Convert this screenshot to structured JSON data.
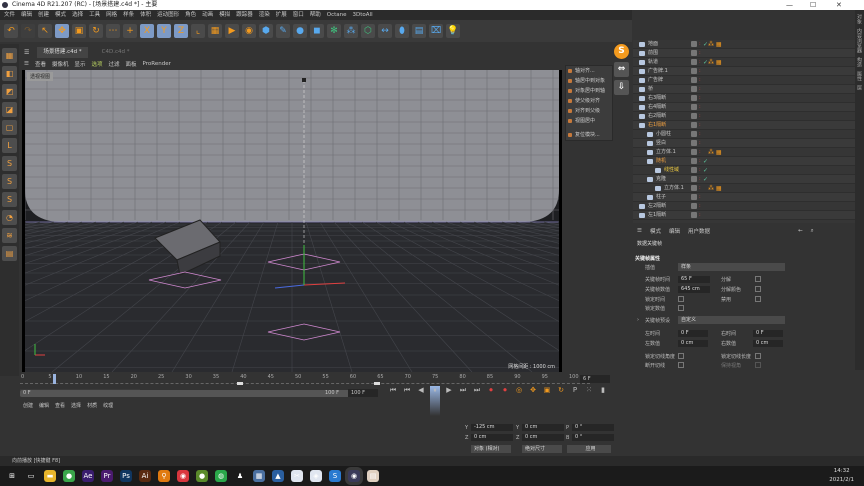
{
  "title": "Cinema 4D R21.207 (RC) - [场景搭建.c4d *] - 主要",
  "window_controls": [
    "—",
    "☐",
    "✕"
  ],
  "menu": [
    "文件",
    "编辑",
    "创建",
    "模式",
    "选择",
    "工具",
    "网格",
    "样条",
    "体积",
    "运动图形",
    "角色",
    "动画",
    "模拟",
    "跟踪器",
    "渲染",
    "扩展",
    "窗口",
    "帮助",
    "Octane",
    "3DtoAll"
  ],
  "toolbar_icons": [
    "undo-icon",
    "redo-icon",
    "select-icon",
    "move-icon",
    "scale-icon",
    "rotate-icon",
    "recent-icon",
    "add-icon",
    "x-axis-icon",
    "y-axis-icon",
    "z-axis-icon",
    "coordinate-icon",
    "render-view-icon",
    "render-picture-icon",
    "render-settings-icon",
    "cube-icon",
    "pen-icon",
    "subdivision-icon",
    "extrude-icon",
    "cloner-icon",
    "mograph-icon",
    "array-icon",
    "deformer-icon",
    "capsule-icon",
    "floor-icon",
    "camera-icon",
    "light-icon"
  ],
  "toolbar_glyphs": [
    "↶",
    "↷",
    "↖",
    "✥",
    "▣",
    "↻",
    "⋯",
    "+",
    "X",
    "Y",
    "Z",
    "⌞",
    "▦",
    "▶",
    "◉",
    "⬢",
    "✎",
    "●",
    "◼",
    "✻",
    "⁂",
    "⬡",
    "↔",
    "⬮",
    "▤",
    "⌧",
    "💡"
  ],
  "left_tools": [
    "▦",
    "◧",
    "◩",
    "◪",
    "▢",
    "L",
    "S",
    "S",
    "S",
    "◔",
    "≋",
    "▤"
  ],
  "tabs": [
    {
      "label": "场景搭建.c4d *",
      "active": true
    },
    {
      "label": "C4D.c4d *",
      "active": false
    }
  ],
  "viewport_menu": [
    "查看",
    "摄像机",
    "显示",
    "选项",
    "过滤",
    "面板",
    "ProRender"
  ],
  "viewport": {
    "label": "透视视图",
    "grid_spacing": "网格间距 : 1000 cm"
  },
  "snap_menu": [
    "轴对齐...",
    "轴居中到对象",
    "对象居中到轴",
    "使父级对齐",
    "对齐到父级",
    "视图居中",
    "复位模块..."
  ],
  "right_buttons": [
    "S",
    "⇔",
    "⇩"
  ],
  "objects": [
    {
      "name": "地面",
      "depth": 0,
      "check": true,
      "tag": true
    },
    {
      "name": "前围",
      "depth": 0
    },
    {
      "name": "轨道",
      "depth": 0,
      "check": true,
      "tag": true
    },
    {
      "name": "广告牌.1",
      "depth": 0
    },
    {
      "name": "广告牌",
      "depth": 0
    },
    {
      "name": "桥",
      "depth": 0
    },
    {
      "name": "右3隔断",
      "depth": 0
    },
    {
      "name": "右4隔断",
      "depth": 0
    },
    {
      "name": "右2隔断",
      "depth": 0
    },
    {
      "name": "右1隔断",
      "depth": 0,
      "hl": true
    },
    {
      "name": "小圆柱",
      "depth": 1
    },
    {
      "name": "竖白",
      "depth": 1
    },
    {
      "name": "立方体.1",
      "depth": 1,
      "tag": true
    },
    {
      "name": "随机",
      "depth": 1,
      "check": true,
      "hl": true
    },
    {
      "name": "线性域",
      "depth": 2,
      "check": true,
      "y": true
    },
    {
      "name": "克隆",
      "depth": 1,
      "check": true
    },
    {
      "name": "立方体.1",
      "depth": 2,
      "tag": true
    },
    {
      "name": "柱子",
      "depth": 1
    },
    {
      "name": "左2隔断",
      "depth": 0
    },
    {
      "name": "左1隔断",
      "depth": 0
    }
  ],
  "right_strip": [
    "对象",
    "内容浏览器",
    "构造",
    "属性",
    "层"
  ],
  "attributes": {
    "tabs": [
      "模式",
      "编辑",
      "用户数据"
    ],
    "heading": "数据关键帧",
    "section": "关键帧属性",
    "interp_label": "插值",
    "interp_value": "样条",
    "time_label": "关键帧时间",
    "time_value": "65 F",
    "value_label": "关键帧数值",
    "value_value": "645 cm",
    "lock_time": "锁定时间",
    "lock_value": "锁定数值",
    "break": "分解",
    "break_color": "分解颜色",
    "mute": "禁用",
    "preset_label": "关键帧预设",
    "preset_value": "自定义",
    "left_time_label": "左时间",
    "left_time": "0 F",
    "left_value_label": "左数值",
    "left_value": "0 cm",
    "right_time_label": "右时间",
    "right_time": "0 F",
    "right_value_label": "右数值",
    "right_value": "0 cm",
    "lock_angle": "锁定切线角度",
    "break_tangent": "断开切线",
    "lock_length": "锁定切线长度",
    "keep_visual": "保持视角"
  },
  "timeline": {
    "ticks": [
      "0",
      "5",
      "10",
      "15",
      "20",
      "25",
      "30",
      "35",
      "40",
      "45",
      "50",
      "55",
      "60",
      "65",
      "70",
      "75",
      "80",
      "85",
      "90",
      "95",
      "100"
    ],
    "current": "6 F",
    "current_frame": 6,
    "keys": [
      40,
      65
    ],
    "start": "0 F",
    "range_start": "0 F",
    "range_end": "100 F",
    "end": "100 F"
  },
  "transport": [
    "⏮",
    "⏮",
    "◀",
    "⏸",
    "▶",
    "⏭",
    "⏭",
    "⏺",
    "⏺",
    "◎",
    "✥",
    "▣",
    "↻",
    "P",
    "⁙",
    "▮"
  ],
  "material_menu": [
    "创建",
    "编辑",
    "查看",
    "选择",
    "材质",
    "纹理"
  ],
  "coords": {
    "y_pos": "-125 cm",
    "z_pos": "0 cm",
    "y_size": "0 cm",
    "z_size": "0 cm",
    "p_rot": "0 °",
    "b_rot": "0 °",
    "mode": "对象 (相对)",
    "size_mode": "绝对尺寸",
    "apply": "应用"
  },
  "status": "向前播放 [快捷键 F8]",
  "taskbar": [
    {
      "g": "⊞",
      "c": "#1b1b1b"
    },
    {
      "g": "▭",
      "c": "#1b1b1b"
    },
    {
      "g": "▬",
      "c": "#e8b52b"
    },
    {
      "g": "●",
      "c": "#3aa64a"
    },
    {
      "g": "Ae",
      "c": "#3a1d6e"
    },
    {
      "g": "Pr",
      "c": "#4a1a6e"
    },
    {
      "g": "Ps",
      "c": "#103660"
    },
    {
      "g": "Ai",
      "c": "#5a2a10"
    },
    {
      "g": "⚲",
      "c": "#e07a10"
    },
    {
      "g": "◉",
      "c": "#d9363e"
    },
    {
      "g": "●",
      "c": "#5a8a2a"
    },
    {
      "g": "◍",
      "c": "#2aa64a"
    },
    {
      "g": "♟",
      "c": "#1b1b1b"
    },
    {
      "g": "▦",
      "c": "#4a6fa0"
    },
    {
      "g": "▲",
      "c": "#2a5fa0"
    },
    {
      "g": "✂",
      "c": "#e0e6f0"
    },
    {
      "g": "◈",
      "c": "#e0e6f0"
    },
    {
      "g": "S",
      "c": "#2a7ad0"
    },
    {
      "g": "◉",
      "c": "#3a3a5a"
    },
    {
      "g": "▤",
      "c": "#e0d0c0"
    }
  ],
  "clock": {
    "time": "14:32",
    "date": "2021/2/1"
  }
}
